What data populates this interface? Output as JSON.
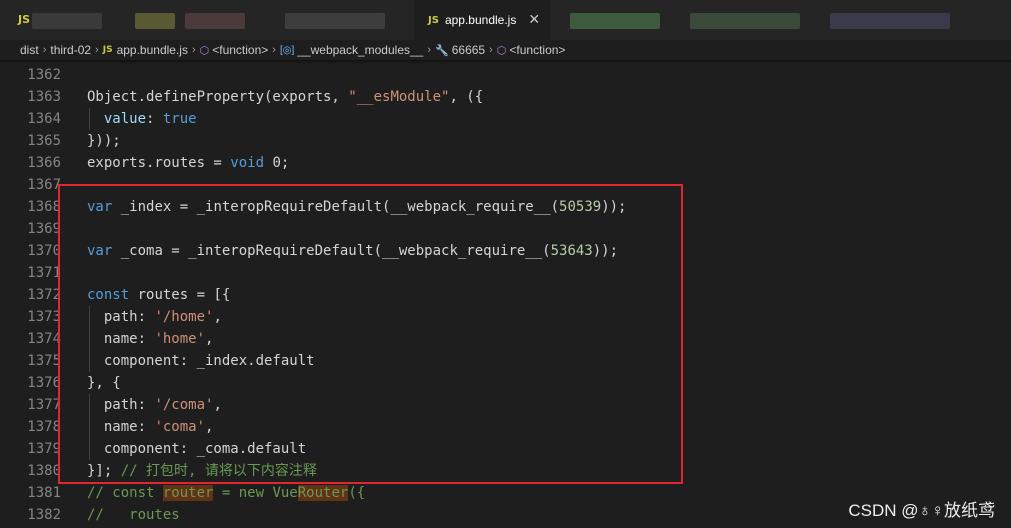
{
  "tabs": {
    "inactive_label": "JS",
    "active": {
      "badge": "JS",
      "title": "app.bundle.js",
      "close": "✕"
    }
  },
  "breadcrumb": {
    "items": [
      "dist",
      "third-02",
      "app.bundle.js",
      "<function>",
      "__webpack_modules__",
      "66665",
      "<function>"
    ],
    "js_badge": "JS",
    "separator": "›"
  },
  "code_lines": [
    {
      "num": "1362",
      "tokens": []
    },
    {
      "num": "1363",
      "tokens": [
        {
          "t": "Object.defineProperty(exports, "
        },
        {
          "t": "\"__esModule\"",
          "c": "str"
        },
        {
          "t": ", ({"
        }
      ]
    },
    {
      "num": "1364",
      "tokens": [
        {
          "t": "  value",
          "c": "prop"
        },
        {
          "t": ": "
        },
        {
          "t": "true",
          "c": "kw"
        }
      ]
    },
    {
      "num": "1365",
      "tokens": [
        {
          "t": "}));"
        }
      ]
    },
    {
      "num": "1366",
      "tokens": [
        {
          "t": "exports.routes = "
        },
        {
          "t": "void",
          "c": "kw"
        },
        {
          "t": " 0;"
        }
      ]
    },
    {
      "num": "1367",
      "tokens": []
    },
    {
      "num": "1368",
      "tokens": [
        {
          "t": "var",
          "c": "kw"
        },
        {
          "t": " _index = _interopRequireDefault(__webpack_require__("
        },
        {
          "t": "50539",
          "c": "num"
        },
        {
          "t": "));"
        }
      ]
    },
    {
      "num": "1369",
      "tokens": []
    },
    {
      "num": "1370",
      "tokens": [
        {
          "t": "var",
          "c": "kw"
        },
        {
          "t": " _coma = _interopRequireDefault(__webpack_require__("
        },
        {
          "t": "53643",
          "c": "num"
        },
        {
          "t": "));"
        }
      ]
    },
    {
      "num": "1371",
      "tokens": []
    },
    {
      "num": "1372",
      "tokens": [
        {
          "t": "const",
          "c": "kw"
        },
        {
          "t": " routes = [{"
        }
      ]
    },
    {
      "num": "1373",
      "tokens": [
        {
          "t": "  path: "
        },
        {
          "t": "'/home'",
          "c": "str"
        },
        {
          "t": ","
        }
      ]
    },
    {
      "num": "1374",
      "tokens": [
        {
          "t": "  name: "
        },
        {
          "t": "'home'",
          "c": "str"
        },
        {
          "t": ","
        }
      ]
    },
    {
      "num": "1375",
      "tokens": [
        {
          "t": "  component: _index.default"
        }
      ]
    },
    {
      "num": "1376",
      "tokens": [
        {
          "t": "}, {"
        }
      ]
    },
    {
      "num": "1377",
      "tokens": [
        {
          "t": "  path: "
        },
        {
          "t": "'/coma'",
          "c": "str"
        },
        {
          "t": ","
        }
      ]
    },
    {
      "num": "1378",
      "tokens": [
        {
          "t": "  name: "
        },
        {
          "t": "'coma'",
          "c": "str"
        },
        {
          "t": ","
        }
      ]
    },
    {
      "num": "1379",
      "tokens": [
        {
          "t": "  component: _coma.default"
        }
      ]
    },
    {
      "num": "1380",
      "tokens": [
        {
          "t": "}]; "
        },
        {
          "t": "// 打包时, 请将以下内容注释",
          "c": "cmt"
        }
      ]
    },
    {
      "num": "1381",
      "tokens": [
        {
          "t": "// const ",
          "c": "cmt"
        },
        {
          "t": "router",
          "c": "cmt hl"
        },
        {
          "t": " = new Vue",
          "c": "cmt"
        },
        {
          "t": "Router",
          "c": "cmt hl"
        },
        {
          "t": "({",
          "c": "cmt"
        }
      ]
    },
    {
      "num": "1382",
      "tokens": [
        {
          "t": "//   routes",
          "c": "cmt"
        }
      ]
    }
  ],
  "watermark": "CSDN @♁♀放纸鸢",
  "colors": {
    "background": "#1e1e1e",
    "highlight_box": "#e0262e",
    "keyword": "#569cd6",
    "string": "#ce9178",
    "number": "#b5cea8",
    "comment": "#6a9955"
  }
}
